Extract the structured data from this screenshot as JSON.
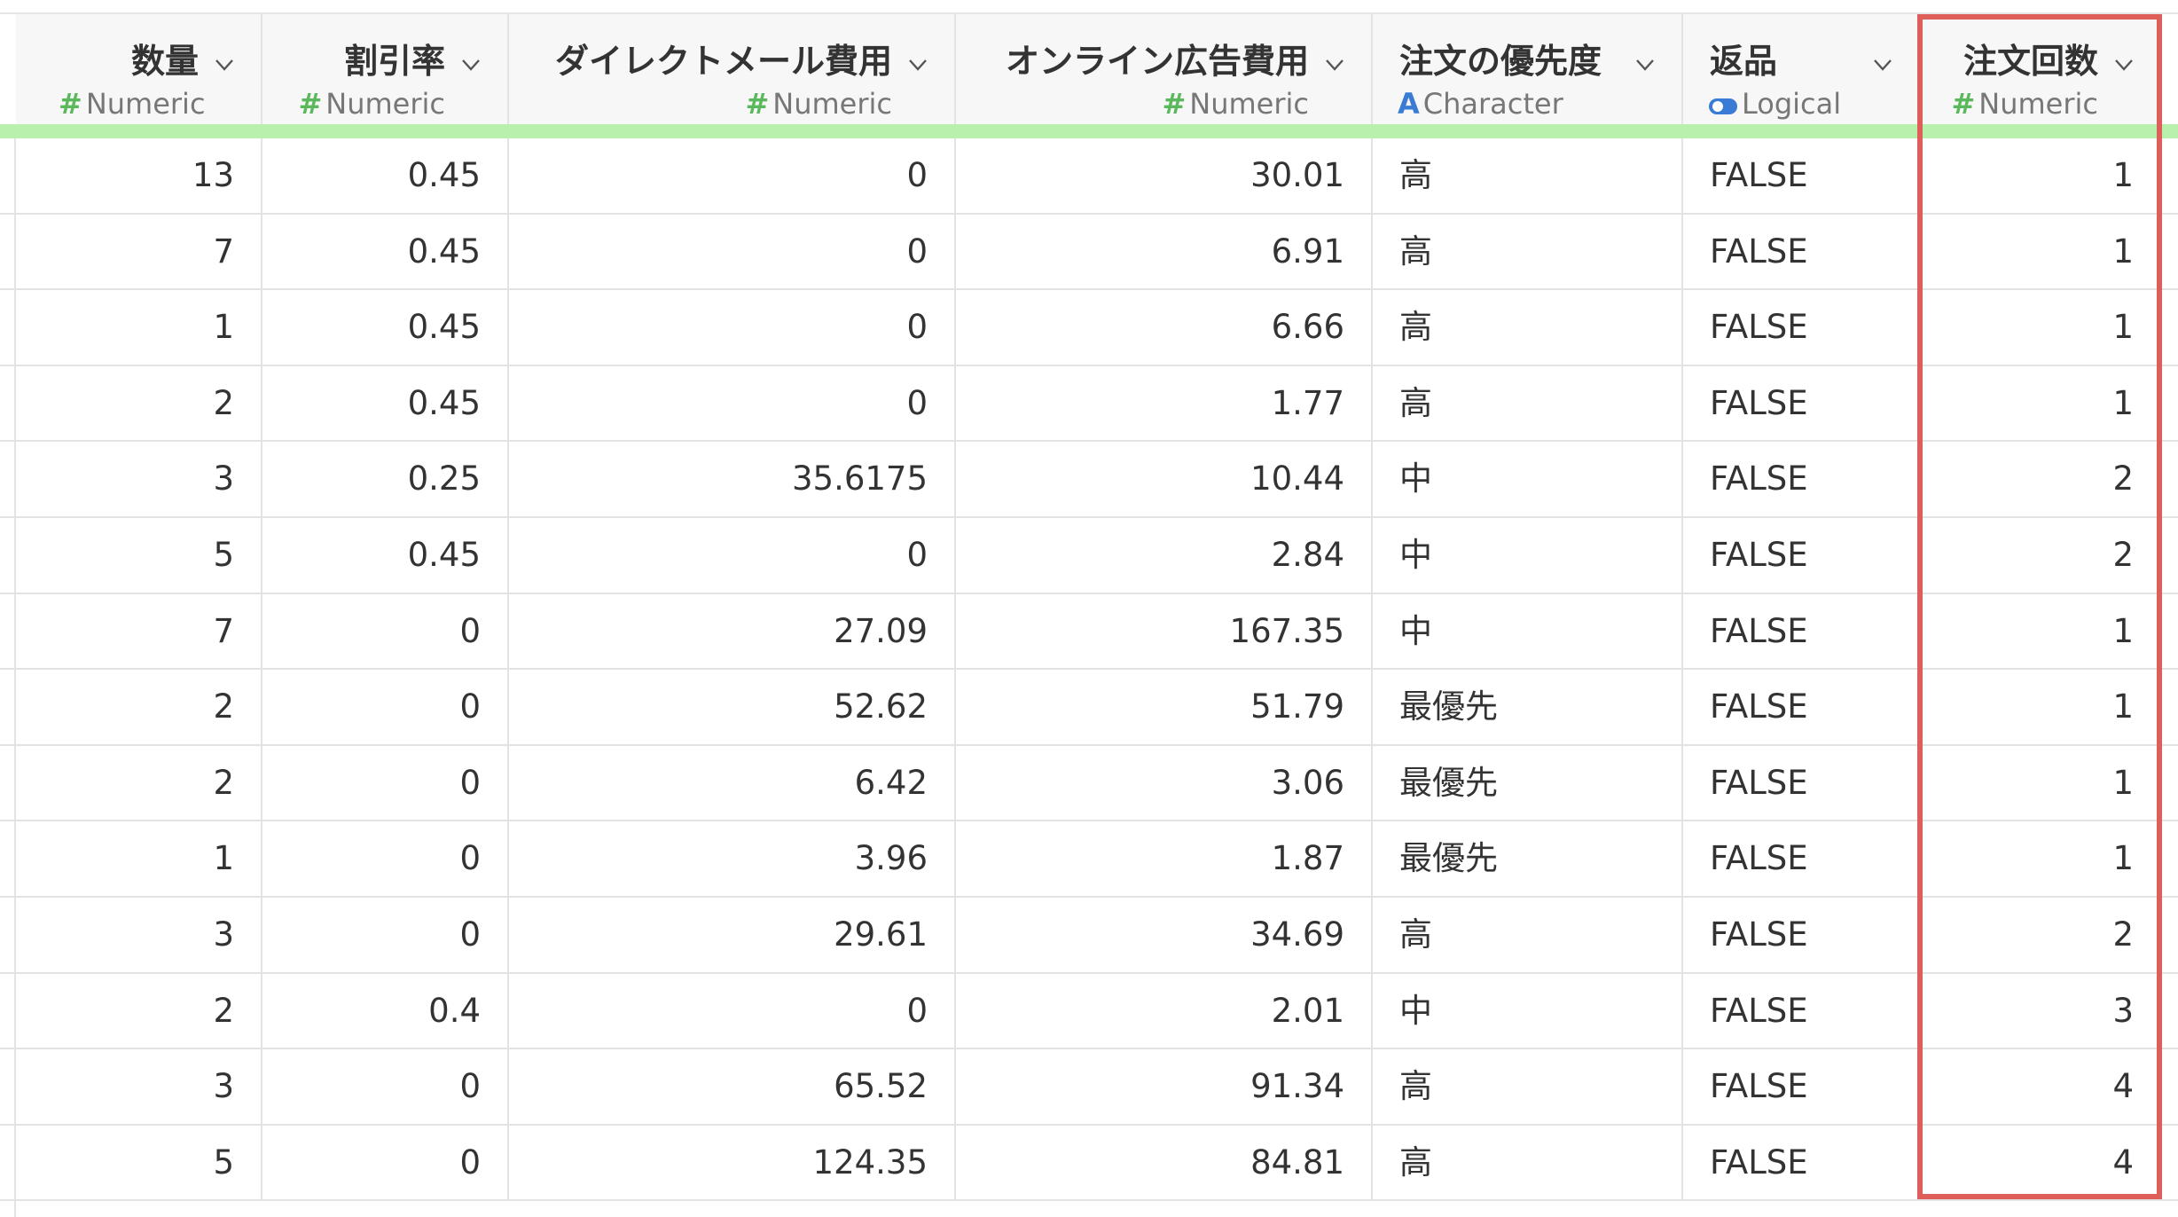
{
  "columns": [
    {
      "key": "qty",
      "name": "数量",
      "type_icon": "#",
      "type": "Numeric",
      "icon_color": "#5cb85c",
      "align": "right"
    },
    {
      "key": "discount",
      "name": "割引率",
      "type_icon": "#",
      "type": "Numeric",
      "icon_color": "#5cb85c",
      "align": "right"
    },
    {
      "key": "dm_cost",
      "name": "ダイレクトメール費用",
      "type_icon": "#",
      "type": "Numeric",
      "icon_color": "#5cb85c",
      "align": "right"
    },
    {
      "key": "ad_cost",
      "name": "オンライン広告費用",
      "type_icon": "#",
      "type": "Numeric",
      "icon_color": "#5cb85c",
      "align": "right"
    },
    {
      "key": "priority",
      "name": "注文の優先度",
      "type_icon": "A",
      "type": "Character",
      "icon_color": "#3a7bd5",
      "align": "left"
    },
    {
      "key": "returned",
      "name": "返品",
      "type_icon": "toggle",
      "type": "Logical",
      "icon_color": "#3a7bd5",
      "align": "left"
    },
    {
      "key": "order_count",
      "name": "注文回数",
      "type_icon": "#",
      "type": "Numeric",
      "icon_color": "#5cb85c",
      "align": "right"
    }
  ],
  "rows": [
    [
      "13",
      "0.45",
      "0",
      "30.01",
      "高",
      "FALSE",
      "1"
    ],
    [
      "7",
      "0.45",
      "0",
      "6.91",
      "高",
      "FALSE",
      "1"
    ],
    [
      "1",
      "0.45",
      "0",
      "6.66",
      "高",
      "FALSE",
      "1"
    ],
    [
      "2",
      "0.45",
      "0",
      "1.77",
      "高",
      "FALSE",
      "1"
    ],
    [
      "3",
      "0.25",
      "35.6175",
      "10.44",
      "中",
      "FALSE",
      "2"
    ],
    [
      "5",
      "0.45",
      "0",
      "2.84",
      "中",
      "FALSE",
      "2"
    ],
    [
      "7",
      "0",
      "27.09",
      "167.35",
      "中",
      "FALSE",
      "1"
    ],
    [
      "2",
      "0",
      "52.62",
      "51.79",
      "最優先",
      "FALSE",
      "1"
    ],
    [
      "2",
      "0",
      "6.42",
      "3.06",
      "最優先",
      "FALSE",
      "1"
    ],
    [
      "1",
      "0",
      "3.96",
      "1.87",
      "最優先",
      "FALSE",
      "1"
    ],
    [
      "3",
      "0",
      "29.61",
      "34.69",
      "高",
      "FALSE",
      "2"
    ],
    [
      "2",
      "0.4",
      "0",
      "2.01",
      "中",
      "FALSE",
      "3"
    ],
    [
      "3",
      "0",
      "65.52",
      "91.34",
      "高",
      "FALSE",
      "4"
    ],
    [
      "5",
      "0",
      "124.35",
      "84.81",
      "高",
      "FALSE",
      "4"
    ]
  ],
  "highlight_color": "#de5f5a",
  "header_accent_color": "#b8f0ad"
}
